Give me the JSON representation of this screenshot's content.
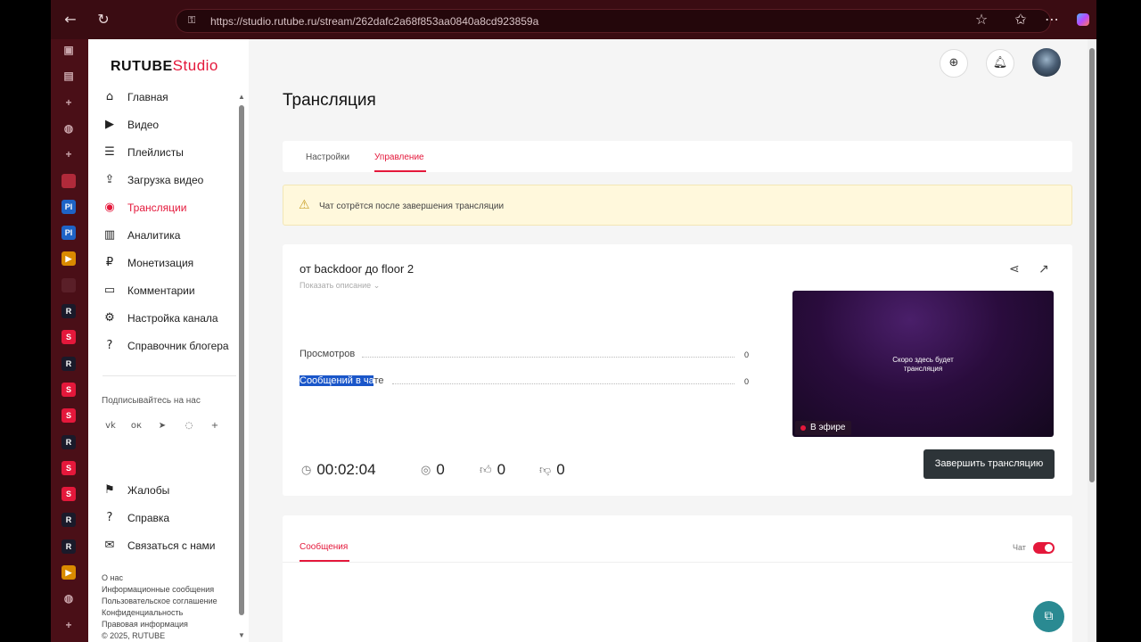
{
  "browser": {
    "url": "https://studio.rutube.ru/stream/262dafc2a68f853aa0840a8cd923859a"
  },
  "tabstrip": {
    "items": [
      {
        "icon": "window-icon",
        "label": ""
      },
      {
        "icon": "box-icon",
        "label": ""
      },
      {
        "icon": "plus-icon",
        "label": ""
      },
      {
        "icon": "globe-icon",
        "label": ""
      },
      {
        "icon": "plus-icon",
        "label": ""
      },
      {
        "icon": "red-dot-icon",
        "label": ""
      },
      {
        "icon": "pi-icon",
        "label": "PI"
      },
      {
        "icon": "pi-icon",
        "label": "PI"
      },
      {
        "icon": "play-icon",
        "label": ""
      },
      {
        "icon": "dark-icon",
        "label": ""
      },
      {
        "icon": "r-icon",
        "label": "R"
      },
      {
        "icon": "s-icon",
        "label": "S"
      },
      {
        "icon": "r-icon",
        "label": "R"
      },
      {
        "icon": "s-icon",
        "label": "S"
      },
      {
        "icon": "s-icon",
        "label": "S"
      },
      {
        "icon": "r-icon",
        "label": "R"
      },
      {
        "icon": "s-icon",
        "label": "S"
      },
      {
        "icon": "s-icon",
        "label": "S"
      },
      {
        "icon": "r-icon",
        "label": "R"
      },
      {
        "icon": "r-icon",
        "label": "R"
      },
      {
        "icon": "play-icon",
        "label": ""
      },
      {
        "icon": "globe-icon",
        "label": ""
      },
      {
        "icon": "plus-icon",
        "label": "+"
      }
    ]
  },
  "logo": {
    "brand": "RUTUBE",
    "product": "Studio"
  },
  "sidebar": {
    "items": [
      {
        "label": "Главная",
        "icon": "⌂"
      },
      {
        "label": "Видео",
        "icon": "▶"
      },
      {
        "label": "Плейлисты",
        "icon": "☰"
      },
      {
        "label": "Загрузка видео",
        "icon": "⇪"
      },
      {
        "label": "Трансляции",
        "icon": "◉"
      },
      {
        "label": "Аналитика",
        "icon": "▥"
      },
      {
        "label": "Монетизация",
        "icon": "₽"
      },
      {
        "label": "Комментарии",
        "icon": "▭"
      },
      {
        "label": "Настройка канала",
        "icon": "⚙"
      },
      {
        "label": "Справочник блогера",
        "icon": "?"
      }
    ],
    "subscribe_label": "Подписывайтесь на нас",
    "social": [
      "vk",
      "ok",
      "tg",
      "vb",
      "+"
    ],
    "bottom_items": [
      {
        "label": "Жалобы",
        "icon": "⚑"
      },
      {
        "label": "Справка",
        "icon": "?"
      },
      {
        "label": "Связаться с нами",
        "icon": "✉"
      }
    ],
    "footer_links": [
      "О нас",
      "Информационные сообщения",
      "Пользовательское соглашение",
      "Конфиденциальность",
      "Правовая информация",
      "© 2025, RUTUBE"
    ]
  },
  "page": {
    "title": "Трансляция",
    "tabs": [
      {
        "label": "Настройки",
        "active": false
      },
      {
        "label": "Управление",
        "active": true
      }
    ],
    "warning": "Чат сотрётся после завершения трансляции",
    "stream": {
      "title": "от backdoor до floor 2",
      "show_description": "Показать описание",
      "stats": [
        {
          "label": "Просмотров",
          "value": "0"
        },
        {
          "label": "Сообщений в чате",
          "value": "0",
          "selected_part": "Сообщений в ча",
          "rest": "те"
        }
      ],
      "preview_text_line1": "Скоро здесь будет",
      "preview_text_line2": "трансляция",
      "live_label": "В эфире",
      "timer": "00:02:04",
      "viewers": "0",
      "likes": "0",
      "dislikes": "0",
      "end_button": "Завершить трансляцию"
    },
    "chat": {
      "tab_label": "Сообщения",
      "toggle_label": "Чат",
      "toggle_on": true
    }
  },
  "colors": {
    "accent": "#e4183b",
    "dark_button": "#2d3438",
    "fab": "#2a8a92"
  }
}
